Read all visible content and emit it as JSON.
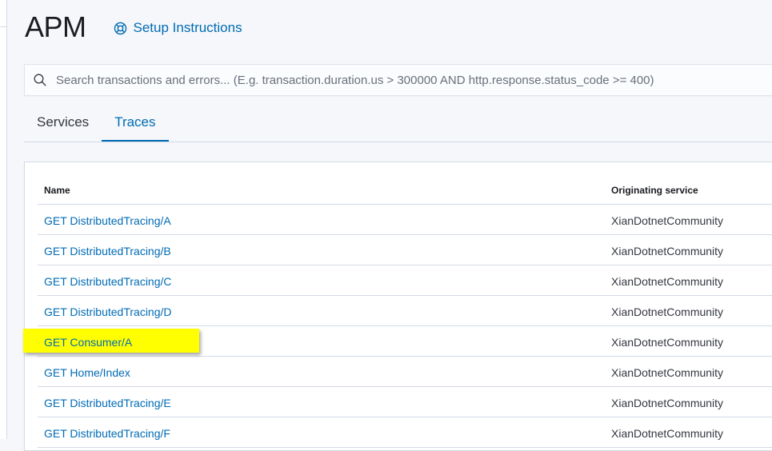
{
  "app": {
    "title": "APM",
    "setup_link": "Setup Instructions"
  },
  "search": {
    "placeholder": "Search transactions and errors... (E.g. transaction.duration.us > 300000 AND http.response.status_code >= 400)",
    "value": ""
  },
  "tabs": [
    {
      "label": "Services",
      "active": false
    },
    {
      "label": "Traces",
      "active": true
    }
  ],
  "table": {
    "headers": {
      "name": "Name",
      "service": "Originating service"
    },
    "rows": [
      {
        "name": "GET DistributedTracing/A",
        "service": "XianDotnetCommunity"
      },
      {
        "name": "GET DistributedTracing/B",
        "service": "XianDotnetCommunity"
      },
      {
        "name": "GET DistributedTracing/C",
        "service": "XianDotnetCommunity"
      },
      {
        "name": "GET DistributedTracing/D",
        "service": "XianDotnetCommunity"
      },
      {
        "name": "GET Consumer/A",
        "service": "XianDotnetCommunity",
        "highlighted": true
      },
      {
        "name": "GET Home/Index",
        "service": "XianDotnetCommunity"
      },
      {
        "name": "GET DistributedTracing/E",
        "service": "XianDotnetCommunity"
      },
      {
        "name": "GET DistributedTracing/F",
        "service": "XianDotnetCommunity"
      }
    ]
  },
  "colors": {
    "link": "#006bb4",
    "highlight": "#ffff00"
  },
  "icons": {
    "setup": "help-lifebuoy-icon",
    "search": "search-icon"
  }
}
